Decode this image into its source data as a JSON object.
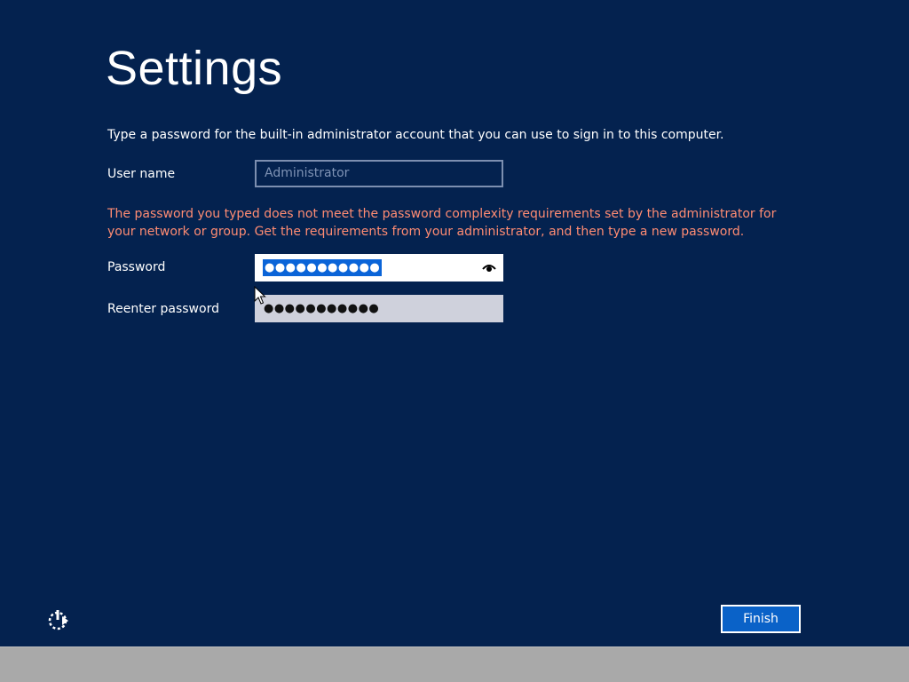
{
  "header": {
    "title": "Settings"
  },
  "form": {
    "instruction": "Type a password for the built-in administrator account that you can use to sign in to this computer.",
    "username_label": "User name",
    "username_value": "Administrator",
    "error_message": "The password you typed does not meet the password complexity requirements set by the administrator for your network or group. Get the requirements from your administrator, and then type a new password.",
    "password_label": "Password",
    "password_value": "●●●●●●●●●●●",
    "reenter_label": "Reenter password",
    "reenter_value": "●●●●●●●●●●●"
  },
  "footer": {
    "finish_label": "Finish"
  },
  "icons": {
    "accessibility": "ease-of-access-icon",
    "reveal": "eye-icon",
    "cursor": "mouse-cursor-icon"
  },
  "colors": {
    "background": "#04224f",
    "error_text": "#ff8c73",
    "button": "#0a62c8",
    "selection": "#0a64d8",
    "taskbar": "#a9a9a9"
  }
}
